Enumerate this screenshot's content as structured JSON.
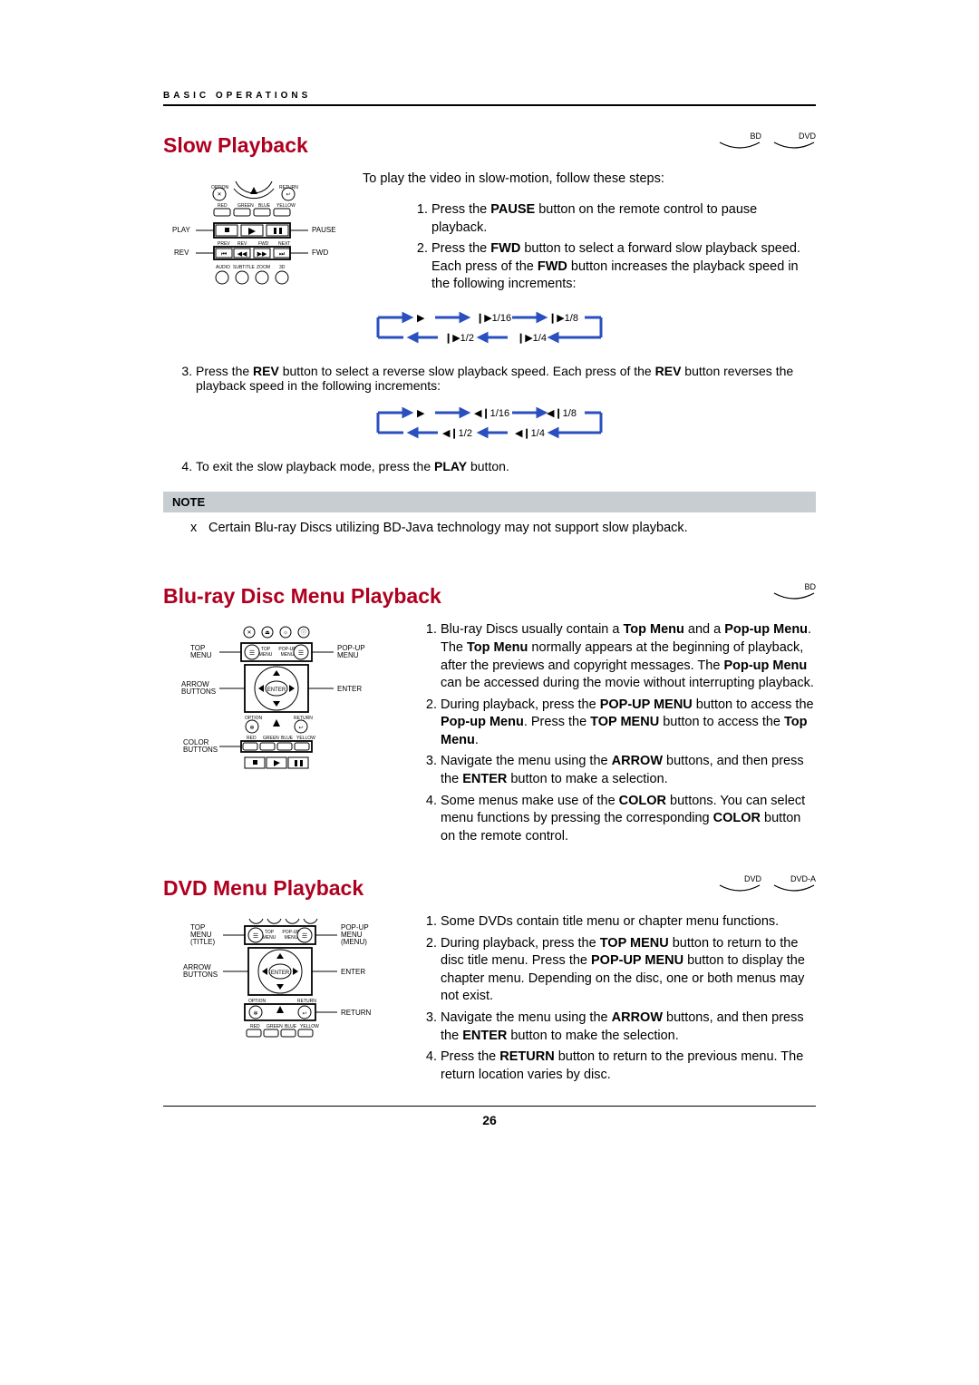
{
  "header": {
    "chapter": "BASIC OPERATIONS"
  },
  "badges": {
    "bd": "BD",
    "dvd": "DVD",
    "dvda": "DVD-A"
  },
  "slow": {
    "title": "Slow Playback",
    "intro": "To play the video in slow-motion, follow these steps:",
    "remote_labels": {
      "option": "OPTION",
      "return": "RETURN",
      "red": "RED",
      "green": "GREEN",
      "blue": "BLUE",
      "yellow": "YELLOW",
      "prev": "PREV",
      "rev": "REV",
      "fwd": "FWD",
      "next": "NEXT",
      "audio": "AUDIO",
      "subtitle": "SUBTITLE",
      "zoom": "ZOOM",
      "three_d": "3D",
      "play": "PLAY",
      "pause": "PAUSE",
      "rev_side": "REV",
      "fwd_side": "FWD"
    },
    "steps_a": [
      {
        "pre": "Press the ",
        "b1": "PAUSE",
        "post": " button on the remote control to pause playback."
      },
      {
        "pre": "Press the ",
        "b1": "FWD",
        "mid": " button to select a forward slow playback speed. Each press of the ",
        "b2": "FWD",
        "post": " button increases the playback speed in the following increments:"
      }
    ],
    "fwd_seq": {
      "s1": "▶",
      "s2": "❙▶1/16",
      "s3": "❙▶1/8",
      "s4": "❙▶1/2",
      "s5": "❙▶1/4"
    },
    "steps_b": [
      {
        "pre": "Press the ",
        "b1": "REV",
        "mid": " button to select a reverse slow playback speed. Each press of the ",
        "b2": "REV",
        "post": " button reverses the playback speed in the following increments:"
      }
    ],
    "rev_seq": {
      "s1": "▶",
      "s2": "◀❙1/16",
      "s3": "◀❙1/8",
      "s4": "◀❙1/2",
      "s5": "◀❙1/4"
    },
    "steps_c": [
      {
        "pre": "To exit the slow playback mode, press the ",
        "b1": "PLAY",
        "post": " button."
      }
    ],
    "note_title": "NOTE",
    "note_x": "x",
    "note_text": "Certain Blu-ray Discs utilizing BD-Java technology may not support slow playback."
  },
  "bluray": {
    "title": "Blu-ray Disc Menu Playback",
    "remote_labels": {
      "top_menu": "TOP\nMENU",
      "popup_menu": "POP-UP\nMENU",
      "arrow_buttons": "ARROW\nBUTTONS",
      "enter": "ENTER",
      "color_buttons": "COLOR\nBUTTONS",
      "red": "RED",
      "green": "GREEN",
      "blue": "BLUE",
      "yellow": "YELLOW",
      "option": "OPTION",
      "return": "RETURN",
      "top_menu_btn": "TOP\nMENU",
      "popup_menu_btn": "POP-UP\nMENU",
      "enter_btn": "ENTER"
    },
    "steps": [
      {
        "t1": "Blu-ray Discs usually contain a ",
        "b1": "Top Menu",
        "t2": " and a ",
        "b2": "Pop-up Menu",
        "t3": ". The ",
        "b3": "Top Menu",
        "t4": " normally appears at the beginning of playback, after the previews and copyright messages. The ",
        "b4": "Pop-up Menu",
        "t5": " can be accessed during the movie without interrupting playback."
      },
      {
        "t1": "During playback, press the ",
        "b1": "POP-UP MENU",
        "t2": " button to access the ",
        "b2": "Pop-up Menu",
        "t3": ". Press the ",
        "b3": "TOP MENU",
        "t4": " button to access the ",
        "b4": "Top Menu",
        "t5": "."
      },
      {
        "t1": "Navigate the menu using the ",
        "b1": "ARROW",
        "t2": " buttons, and then press the ",
        "b2": "ENTER",
        "t3": " button to make a selection."
      },
      {
        "t1": "Some menus make use of the ",
        "b1": "COLOR",
        "t2": " buttons. You can select menu functions by pressing the corresponding ",
        "b2": "COLOR",
        "t3": " button on the remote control."
      }
    ]
  },
  "dvd": {
    "title": "DVD Menu Playback",
    "remote_labels": {
      "top_menu_title": "TOP\nMENU\n(TITLE)",
      "popup_menu_menu": "POP-UP\nMENU\n(MENU)",
      "arrow_buttons": "ARROW\nBUTTONS",
      "enter": "ENTER",
      "return": "RETURN",
      "option": "OPTION",
      "red": "RED",
      "green": "GREEN",
      "blue": "BLUE",
      "yellow": "YELLOW",
      "top_menu_btn": "TOP\nMENU",
      "popup_menu_btn": "POP-UP\nMENU",
      "enter_btn": "ENTER",
      "return_btn": "RETURN"
    },
    "steps": [
      {
        "t1": "Some DVDs contain title menu or chapter menu functions."
      },
      {
        "t1": "During playback, press the ",
        "b1": "TOP MENU",
        "t2": " button to return to the disc title menu. Press the ",
        "b2": "POP-UP MENU",
        "t3": " button to display the chapter menu. Depending on the disc, one or both menus may not exist."
      },
      {
        "t1": "Navigate the menu using the ",
        "b1": "ARROW",
        "t2": " buttons, and then press the ",
        "b2": "ENTER",
        "t3": " button to make the selection."
      },
      {
        "t1": "Press the ",
        "b1": "RETURN",
        "t2": " button to return to the previous menu. The return location varies by disc."
      }
    ]
  },
  "page_number": "26"
}
